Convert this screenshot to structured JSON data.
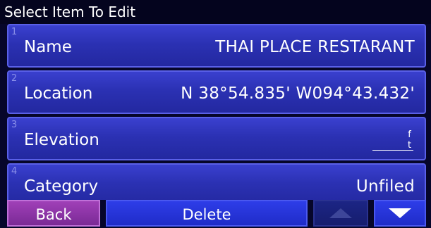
{
  "header": {
    "title": "Select Item To Edit"
  },
  "rows": [
    {
      "num": "1",
      "label": "Name",
      "value": "THAI PLACE RESTARANT"
    },
    {
      "num": "2",
      "label": "Location",
      "value": "N 38°54.835' W094°43.432'"
    },
    {
      "num": "3",
      "label": "Elevation",
      "value": "",
      "unit": "ft"
    },
    {
      "num": "4",
      "label": "Category",
      "value": "Unfiled"
    }
  ],
  "footer": {
    "back_label": "Back",
    "delete_label": "Delete",
    "up_icon": "up-arrow-icon",
    "down_icon": "down-arrow-icon"
  },
  "colors": {
    "row_blue": "#2b31b3",
    "back_purple": "#8a32a6",
    "delete_blue": "#2533d8",
    "disabled_up": "#1c2585"
  }
}
